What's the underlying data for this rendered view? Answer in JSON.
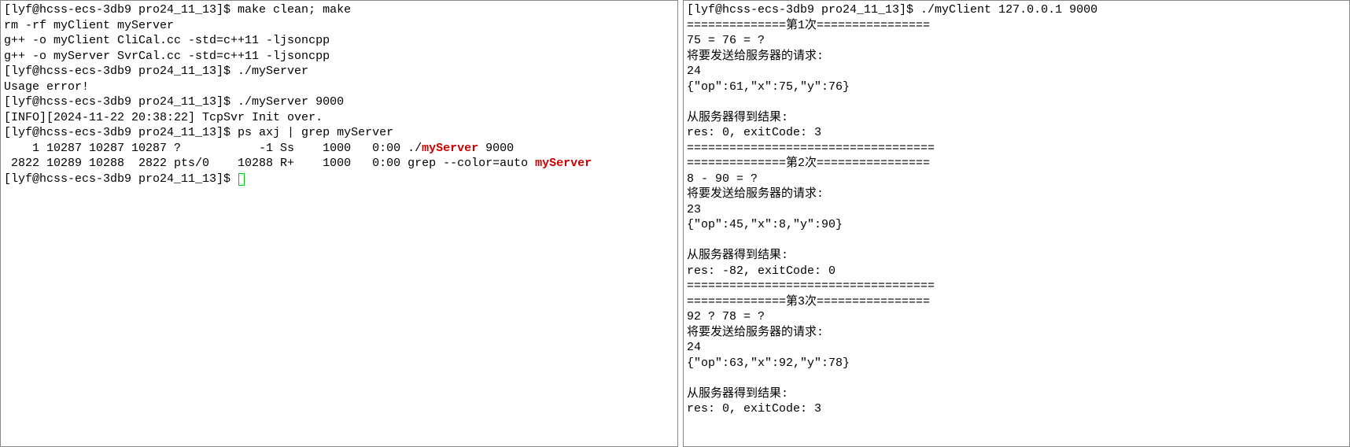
{
  "left": {
    "lines": [
      {
        "segments": [
          {
            "text": "[lyf@hcss-ecs-3db9 pro24_11_13]$ make clean; make"
          }
        ]
      },
      {
        "segments": [
          {
            "text": "rm -rf myClient myServer"
          }
        ]
      },
      {
        "segments": [
          {
            "text": "g++ -o myClient CliCal.cc -std=c++11 -ljsoncpp"
          }
        ]
      },
      {
        "segments": [
          {
            "text": "g++ -o myServer SvrCal.cc -std=c++11 -ljsoncpp"
          }
        ]
      },
      {
        "segments": [
          {
            "text": "[lyf@hcss-ecs-3db9 pro24_11_13]$ ./myServer"
          }
        ]
      },
      {
        "segments": [
          {
            "text": "Usage error!"
          }
        ]
      },
      {
        "segments": [
          {
            "text": "[lyf@hcss-ecs-3db9 pro24_11_13]$ ./myServer 9000"
          }
        ]
      },
      {
        "segments": [
          {
            "text": "[INFO][2024-11-22 20:38:22] TcpSvr Init over."
          }
        ]
      },
      {
        "segments": [
          {
            "text": "[lyf@hcss-ecs-3db9 pro24_11_13]$ ps axj | grep myServer"
          }
        ]
      },
      {
        "segments": [
          {
            "text": "    1 10287 10287 10287 ?           -1 Ss    1000   0:00 ./"
          },
          {
            "text": "myServer",
            "class": "hl-red"
          },
          {
            "text": " 9000"
          }
        ]
      },
      {
        "segments": [
          {
            "text": " 2822 10289 10288  2822 pts/0    10288 R+    1000   0:00 grep --color=auto "
          },
          {
            "text": "myServer",
            "class": "hl-red"
          }
        ]
      },
      {
        "segments": [
          {
            "text": "[lyf@hcss-ecs-3db9 pro24_11_13]$ "
          }
        ],
        "cursor": true
      }
    ]
  },
  "right": {
    "lines": [
      {
        "segments": [
          {
            "text": "[lyf@hcss-ecs-3db9 pro24_11_13]$ ./myClient 127.0.0.1 9000"
          }
        ]
      },
      {
        "segments": [
          {
            "text": "==============第1次================"
          }
        ]
      },
      {
        "segments": [
          {
            "text": "75 = 76 = ?"
          }
        ]
      },
      {
        "segments": [
          {
            "text": "将要发送给服务器的请求:"
          }
        ]
      },
      {
        "segments": [
          {
            "text": "24"
          }
        ]
      },
      {
        "segments": [
          {
            "text": "{\"op\":61,\"x\":75,\"y\":76}"
          }
        ]
      },
      {
        "segments": [
          {
            "text": " "
          }
        ]
      },
      {
        "segments": [
          {
            "text": "从服务器得到结果:"
          }
        ]
      },
      {
        "segments": [
          {
            "text": "res: 0, exitCode: 3"
          }
        ]
      },
      {
        "segments": [
          {
            "text": "==================================="
          }
        ]
      },
      {
        "segments": [
          {
            "text": "==============第2次================"
          }
        ]
      },
      {
        "segments": [
          {
            "text": "8 - 90 = ?"
          }
        ]
      },
      {
        "segments": [
          {
            "text": "将要发送给服务器的请求:"
          }
        ]
      },
      {
        "segments": [
          {
            "text": "23"
          }
        ]
      },
      {
        "segments": [
          {
            "text": "{\"op\":45,\"x\":8,\"y\":90}"
          }
        ]
      },
      {
        "segments": [
          {
            "text": " "
          }
        ]
      },
      {
        "segments": [
          {
            "text": "从服务器得到结果:"
          }
        ]
      },
      {
        "segments": [
          {
            "text": "res: -82, exitCode: 0"
          }
        ]
      },
      {
        "segments": [
          {
            "text": "==================================="
          }
        ]
      },
      {
        "segments": [
          {
            "text": "==============第3次================"
          }
        ]
      },
      {
        "segments": [
          {
            "text": "92 ? 78 = ?"
          }
        ]
      },
      {
        "segments": [
          {
            "text": "将要发送给服务器的请求:"
          }
        ]
      },
      {
        "segments": [
          {
            "text": "24"
          }
        ]
      },
      {
        "segments": [
          {
            "text": "{\"op\":63,\"x\":92,\"y\":78}"
          }
        ]
      },
      {
        "segments": [
          {
            "text": " "
          }
        ]
      },
      {
        "segments": [
          {
            "text": "从服务器得到结果:"
          }
        ]
      },
      {
        "segments": [
          {
            "text": "res: 0, exitCode: 3"
          }
        ]
      }
    ]
  }
}
